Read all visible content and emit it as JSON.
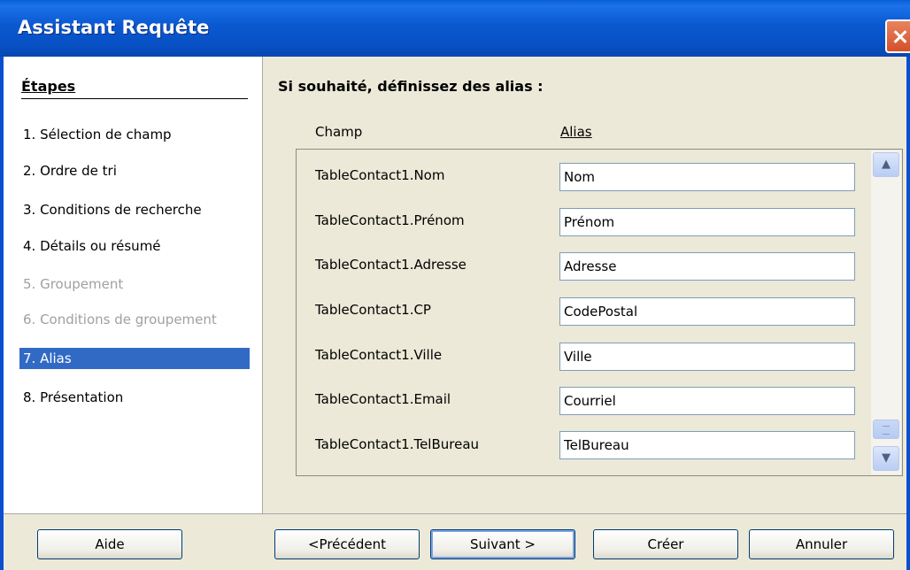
{
  "window": {
    "title": "Assistant Requête"
  },
  "steps": {
    "title": "Étapes",
    "items": [
      {
        "label": "1.  Sélection de champ",
        "state": "normal"
      },
      {
        "label": "2.  Ordre de tri",
        "state": "normal"
      },
      {
        "label": "3.  Conditions de recherche",
        "state": "normal"
      },
      {
        "label": "4.  Détails ou résumé",
        "state": "normal"
      },
      {
        "label": "5.  Groupement",
        "state": "disabled"
      },
      {
        "label": "6.  Conditions de groupement",
        "state": "disabled"
      },
      {
        "label": "7.  Alias",
        "state": "active"
      },
      {
        "label": "8.  Présentation",
        "state": "normal"
      }
    ]
  },
  "content": {
    "title": "Si souhaité, définissez des alias :",
    "column_field": "Champ",
    "column_alias": "Alias",
    "rows": [
      {
        "field": "TableContact1.Nom",
        "alias": "Nom"
      },
      {
        "field": "TableContact1.Prénom",
        "alias": "Prénom"
      },
      {
        "field": "TableContact1.Adresse",
        "alias": "Adresse"
      },
      {
        "field": "TableContact1.CP",
        "alias": "CodePostal"
      },
      {
        "field": "TableContact1.Ville",
        "alias": "Ville"
      },
      {
        "field": "TableContact1.Email",
        "alias": "Courriel"
      },
      {
        "field": "TableContact1.TelBureau",
        "alias": "TelBureau"
      }
    ]
  },
  "buttons": {
    "help": "Aide",
    "previous": "<Précédent",
    "next": "Suivant >",
    "create": "Créer",
    "cancel": "Annuler"
  },
  "icons": {
    "close": "close-icon",
    "scroll_up": "chevron-up-icon",
    "scroll_down": "chevron-down-icon"
  }
}
